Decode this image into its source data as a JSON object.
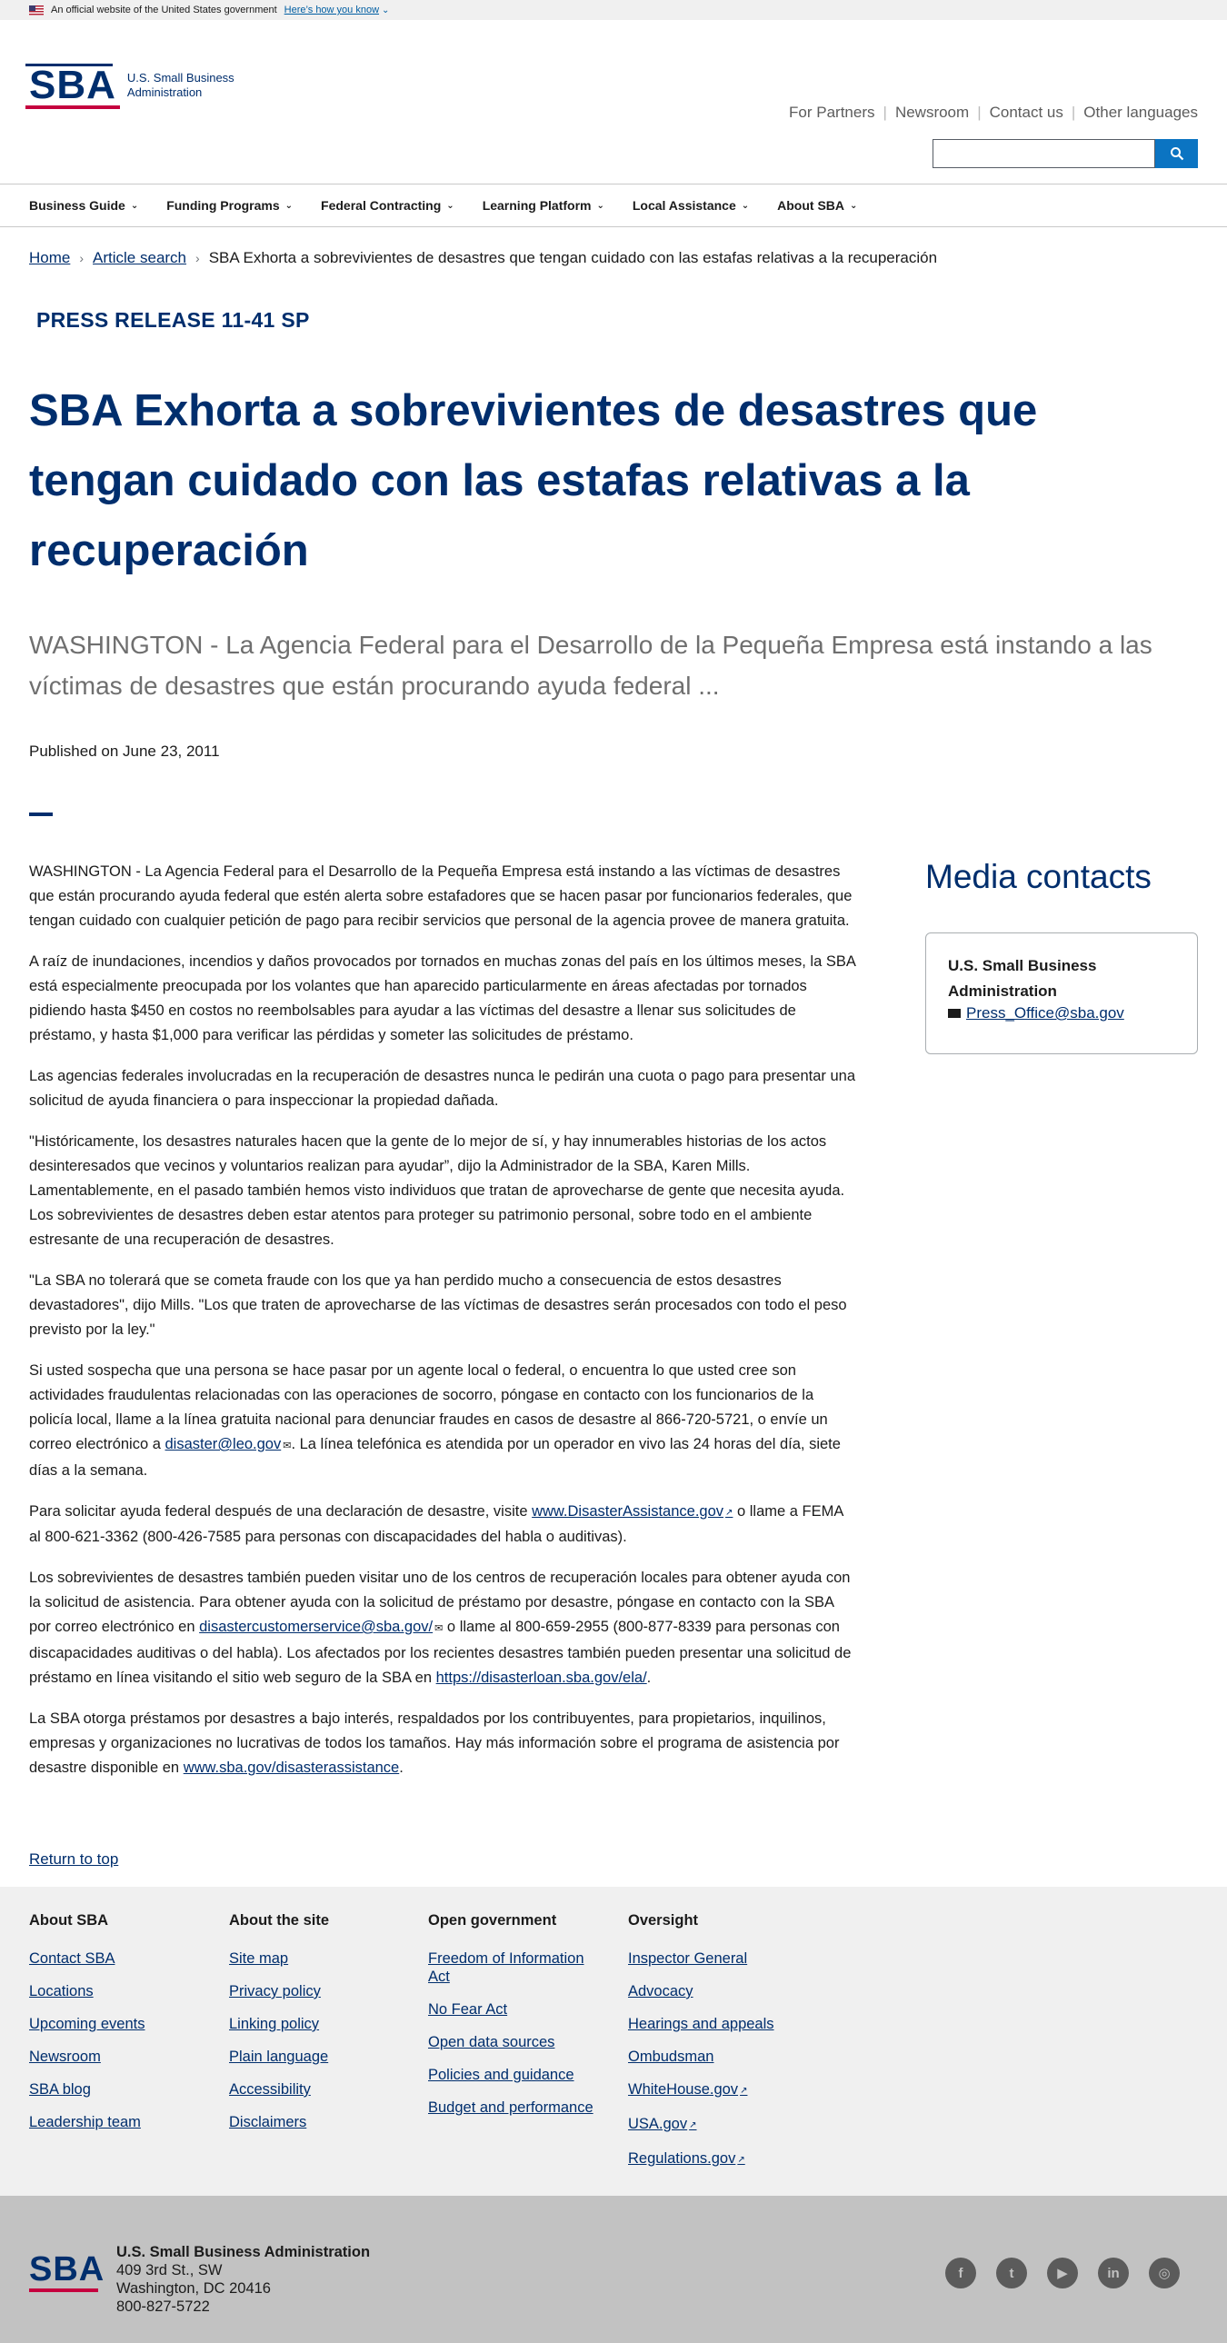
{
  "gov_banner": {
    "text": "An official website of the United States government",
    "link": "Here’s how you know"
  },
  "header": {
    "logo_text_1": "U.S. Small Business",
    "logo_text_2": "Administration",
    "logo_mark": "SBA",
    "utility_links": [
      "For Partners",
      "Newsroom",
      "Contact us",
      "Other languages"
    ],
    "search_placeholder": ""
  },
  "nav": {
    "items": [
      "Business Guide",
      "Funding Programs",
      "Federal Contracting",
      "Learning Platform",
      "Local Assistance",
      "About SBA"
    ]
  },
  "breadcrumb": {
    "home": "Home",
    "search": "Article search",
    "current": "SBA Exhorta a sobrevivientes de desastres que tengan cuidado con las estafas relativas a la recuperación"
  },
  "article": {
    "eyebrow": "PRESS RELEASE 11-41 SP",
    "title": "SBA Exhorta a sobrevivientes de desastres que tengan cuidado con las estafas relativas a la recuperación",
    "subtitle": "WASHINGTON - La Agencia Federal para el Desarrollo de la Pequeña Empresa está instando a las víctimas de desastres que están procurando ayuda federal ...",
    "published": "Published on June 23, 2011",
    "p1": "WASHINGTON - La Agencia Federal para el Desarrollo de la Pequeña Empresa está instando a las víctimas de desastres que están procurando ayuda federal que estén alerta sobre estafadores que se hacen pasar por funcionarios federales, que tengan cuidado con cualquier petición de pago para recibir servicios que personal de la agencia provee de manera gratuita.",
    "p2": "A raíz de inundaciones, incendios y daños provocados por tornados en muchas zonas del país en los últimos meses, la SBA está especialmente preocupada por los volantes que han aparecido particularmente en áreas afectadas por tornados  pidiendo hasta $450 en costos no reembolsables para ayudar a las víctimas del desastre a llenar sus solicitudes de préstamo, y hasta $1,000 para verificar las pérdidas y someter las solicitudes de préstamo.",
    "p3": "Las agencias federales involucradas en la recuperación de desastres nunca le pedirán una cuota o pago para presentar una solicitud de ayuda financiera o para inspeccionar la propiedad dañada.",
    "p4": "\"Históricamente, los desastres naturales hacen que la gente de lo mejor de sí, y hay innumerables historias de los actos desinteresados que vecinos y voluntarios realizan para ayudar”, dijo la Administrador de la SBA, Karen Mills. Lamentablemente, en el pasado también hemos visto individuos que tratan de aprovecharse de gente que necesita ayuda.  Los sobrevivientes de desastres deben estar atentos para proteger su patrimonio personal, sobre todo en el ambiente estresante de una recuperación de desastres.",
    "p5": "\"La SBA no tolerará que se cometa fraude con los que ya han perdido mucho a consecuencia de estos desastres devastadores\", dijo Mills. \"Los que traten de aprovecharse de las víctimas de desastres serán procesados con todo el peso previsto por la ley.\"",
    "p6_a": "Si usted sospecha que una persona se hace pasar por un agente local o federal, o encuentra lo que usted cree son actividades fraudulentas relacionadas con las operaciones de socorro, póngase en contacto con los funcionarios de la policía local, llame a la línea gratuita nacional para denunciar fraudes en casos de desastre al 866-720-5721, o envíe un correo electrónico a ",
    "p6_link": "disaster@leo.gov",
    "p6_b": ".  La línea telefónica es atendida por un operador en vivo las 24 horas del día, siete días a la semana.",
    "p7_a": "Para solicitar ayuda federal después de una declaración de desastre, visite ",
    "p7_link": "www.DisasterAssistance.gov",
    "p7_b": "  o llame a FEMA al 800-621-3362 (800-426-7585 para personas con discapacidades del habla o auditivas).",
    "p8_a": "Los sobrevivientes de desastres también pueden visitar uno de los centros de recuperación locales para obtener ayuda con la solicitud de asistencia. Para obtener ayuda con la solicitud de préstamo por desastre, póngase en contacto con la SBA por correo electrónico en ",
    "p8_link1": "disastercustomerservice@sba.gov/",
    "p8_b": "  o llame al 800-659-2955 (800-877-8339 para personas con discapacidades auditivas o del habla). Los afectados por los recientes desastres también pueden presentar una solicitud de préstamo en línea visitando el sitio web seguro de la SBA en ",
    "p8_link2": "https://disasterloan.sba.gov/ela/",
    "p8_c": ".",
    "p9_a": "La SBA otorga préstamos por desastres a bajo interés, respaldados por los contribuyentes, para propietarios, inquilinos, empresas y organizaciones no lucrativas de todos los tamaños. Hay más información sobre el programa de asistencia por desastre disponible en ",
    "p9_link": "www.sba.gov/disasterassistance",
    "p9_b": "."
  },
  "media": {
    "heading": "Media contacts",
    "org": "U.S. Small Business Administration",
    "email": "Press_Office@sba.gov"
  },
  "return_top": "Return to top",
  "footer": {
    "columns": [
      {
        "title": "About SBA",
        "links": [
          "Contact SBA",
          "Locations",
          "Upcoming events",
          "Newsroom",
          "SBA blog",
          "Leadership team"
        ]
      },
      {
        "title": "About the site",
        "links": [
          "Site map",
          "Privacy policy",
          "Linking policy",
          "Plain language",
          "Accessibility",
          "Disclaimers"
        ]
      },
      {
        "title": "Open government",
        "links": [
          "Freedom of Information Act",
          "No Fear Act",
          "Open data sources",
          "Policies and guidance",
          "Budget and performance"
        ]
      },
      {
        "title": "Oversight",
        "links": [
          "Inspector General",
          "Advocacy",
          "Hearings and appeals",
          "Ombudsman",
          "WhiteHouse.gov",
          "USA.gov",
          "Regulations.gov"
        ]
      }
    ]
  },
  "bottom": {
    "org": "U.S. Small Business Administration",
    "address1": "409 3rd St., SW",
    "address2": "Washington, DC 20416",
    "phone": "800-827-5722",
    "social": [
      "facebook-icon",
      "twitter-icon",
      "youtube-icon",
      "linkedin-icon",
      "instagram-icon"
    ]
  },
  "colors": {
    "navy": "#002e6d",
    "red": "#c5003e",
    "search_blue": "#0b74c2"
  }
}
